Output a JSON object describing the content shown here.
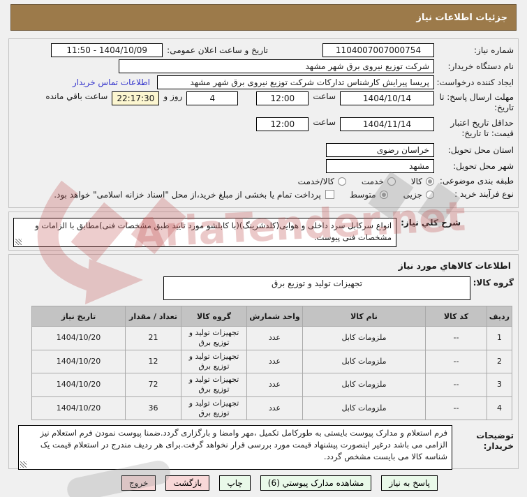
{
  "title_bar": {
    "label": "جزئیات اطلاعات نیاز"
  },
  "form": {
    "need_number": {
      "label": "شماره نیاز:",
      "value": "1104007007000754"
    },
    "announce_datetime": {
      "label": "تاریخ و ساعت اعلان عمومی:",
      "value": "1404/10/09 - 11:50"
    },
    "buyer_org": {
      "label": "نام دستگاه خریدار:",
      "value": "شرکت توزیع نیروی برق شهر مشهد"
    },
    "request_creator": {
      "label": "ایجاد کننده درخواست:",
      "value": "پریسا پیرایش کارشناس تدارکات شرکت توزیع نیروی برق شهر مشهد",
      "contact_link": "اطلاعات تماس خریدار"
    },
    "response_deadline": {
      "label": "مهلت ارسال پاسخ: تا تاریخ:",
      "date": "1404/10/14",
      "hour_label": "ساعت",
      "time": "12:00",
      "days": "4",
      "days_label": "روز و",
      "countdown": "22:17:30",
      "remaining_label": "ساعت باقي مانده"
    },
    "price_validity": {
      "label": "حداقل تاریخ اعتبار قیمت: تا تاریخ:",
      "date": "1404/11/14",
      "hour_label": "ساعت",
      "time": "12:00"
    },
    "province": {
      "label": "استان محل تحویل:",
      "value": "خراسان رضوی"
    },
    "city": {
      "label": "شهر محل تحویل:",
      "value": "مشهد"
    },
    "subject_class": {
      "label": "طبقه بندی موضوعی:",
      "options": [
        {
          "label": "کالا",
          "selected": true
        },
        {
          "label": "خدمت",
          "selected": false
        },
        {
          "label": "کالا/خدمت",
          "selected": false
        }
      ]
    },
    "process_type": {
      "label": "نوع فرآیند خرید :",
      "options": [
        {
          "label": "جزیی",
          "selected": false
        },
        {
          "label": "متوسط",
          "selected": true
        }
      ],
      "checkbox_label": "پرداخت تمام یا بخشی از مبلغ خرید،از محل \"اسناد خزانه اسلامی\" خواهد بود.",
      "checkbox_checked": false
    }
  },
  "need_desc": {
    "label": "شرح كلي نياز:",
    "value": "انواع سرکابل سرد داخلی و هوایی(کلدشرینگ)(با کابلشو مورد تایید طبق مشخصات فنی)مطابق با الزامات و مشخصات فنی پیوست."
  },
  "goods_section": {
    "header": "اطلاعات كالاهاي مورد نياز",
    "group": {
      "label": "گروه کالا:",
      "value": "تجهیزات تولید و توزیع برق"
    },
    "table": {
      "headers": [
        "ردیف",
        "کد کالا",
        "نام کالا",
        "واحد شمارش",
        "گروه کالا",
        "تعداد / مقدار",
        "تاریخ نیاز"
      ],
      "rows": [
        [
          "1",
          "--",
          "ملزومات کابل",
          "عدد",
          "تجهیزات تولید و توزیع برق",
          "21",
          "1404/10/20"
        ],
        [
          "2",
          "--",
          "ملزومات کابل",
          "عدد",
          "تجهیزات تولید و توزیع برق",
          "12",
          "1404/10/20"
        ],
        [
          "3",
          "--",
          "ملزومات کابل",
          "عدد",
          "تجهیزات تولید و توزیع برق",
          "72",
          "1404/10/20"
        ],
        [
          "4",
          "--",
          "ملزومات کابل",
          "عدد",
          "تجهیزات تولید و توزیع برق",
          "36",
          "1404/10/20"
        ]
      ]
    }
  },
  "buyer_notes": {
    "label": "توضيحات خريدار:",
    "value": "فرم استعلام و مدارک پیوست بایستی به طورکامل تکمیل ،مهر وامضا و بارگزاری گردد.ضمنا پیوست نمودن فرم استعلام نیز الزامی می باشد درغیر اینصورت پیشنهاد قیمت مورد بررسی قرار نخواهد گرفت.برای هر ردیف مندرج در استعلام قیمت یک شناسه کالا می بایست مشخص گردد."
  },
  "buttons": [
    {
      "name": "respond-to-need-button",
      "label": "پاسخ به نیاز",
      "style": "green"
    },
    {
      "name": "view-attachments-button",
      "label": "مشاهده مدارک پیوستي (6)",
      "style": "green"
    },
    {
      "name": "print-button",
      "label": "چاپ",
      "style": "green"
    },
    {
      "name": "back-button",
      "label": "بازگشت",
      "style": "pink"
    },
    {
      "name": "exit-button",
      "label": "خروج",
      "style": "pink"
    }
  ],
  "watermark": {
    "text": "AriaTender.net"
  },
  "colors": {
    "title_bar": "#9c7a4a",
    "countdown_bg": "#fcf6d0",
    "link": "#3333cc",
    "table_header_bg": "#c3c3c3",
    "button_green": "#e9f9e9",
    "button_pink": "#f8d8d8"
  }
}
